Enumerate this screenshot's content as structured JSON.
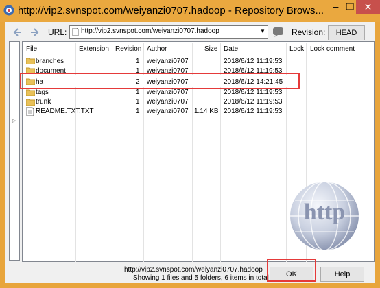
{
  "window": {
    "title": "http://vip2.svnspot.com/weiyanzi0707.hadoop - Repository Brows...",
    "minimize_glyph": "–",
    "close_glyph": "✕"
  },
  "toolbar": {
    "url_label": "URL:",
    "url_value": "http://vip2.svnspot.com/weiyanzi0707.hadoop",
    "revision_label": "Revision:",
    "head_button": "HEAD"
  },
  "columns": [
    "File",
    "Extension",
    "Revision",
    "Author",
    "Size",
    "Date",
    "Lock",
    "Lock comment"
  ],
  "rows": [
    {
      "name": "branches",
      "ext": "",
      "rev": "1",
      "author": "weiyanzi0707",
      "size": "",
      "date": "2018/6/12 11:19:53",
      "kind": "folder"
    },
    {
      "name": "document",
      "ext": "",
      "rev": "1",
      "author": "weiyanzi0707",
      "size": "",
      "date": "2018/6/12 11:19:53",
      "kind": "folder"
    },
    {
      "name": "ha",
      "ext": "",
      "rev": "2",
      "author": "weiyanzi0707",
      "size": "",
      "date": "2018/6/12 14:21:45",
      "kind": "folder"
    },
    {
      "name": "tags",
      "ext": "",
      "rev": "1",
      "author": "weiyanzi0707",
      "size": "",
      "date": "2018/6/12 11:19:53",
      "kind": "folder"
    },
    {
      "name": "trunk",
      "ext": "",
      "rev": "1",
      "author": "weiyanzi0707",
      "size": "",
      "date": "2018/6/12 11:19:53",
      "kind": "folder"
    },
    {
      "name": "README.TXT",
      "ext": ".TXT",
      "rev": "1",
      "author": "weiyanzi0707",
      "size": "1.14 KB",
      "date": "2018/6/12 11:19:53",
      "kind": "file"
    }
  ],
  "status": {
    "path": "http://vip2.svnspot.com/weiyanzi0707.hadoop",
    "summary": "Showing 1 files and 5 folders, 6 items in total"
  },
  "buttons": {
    "ok": "OK",
    "help": "Help"
  },
  "watermark": {
    "text": "http"
  },
  "colors": {
    "frame": "#e8a53c",
    "highlight": "#e53a3a",
    "folder": "#e8c15a"
  }
}
